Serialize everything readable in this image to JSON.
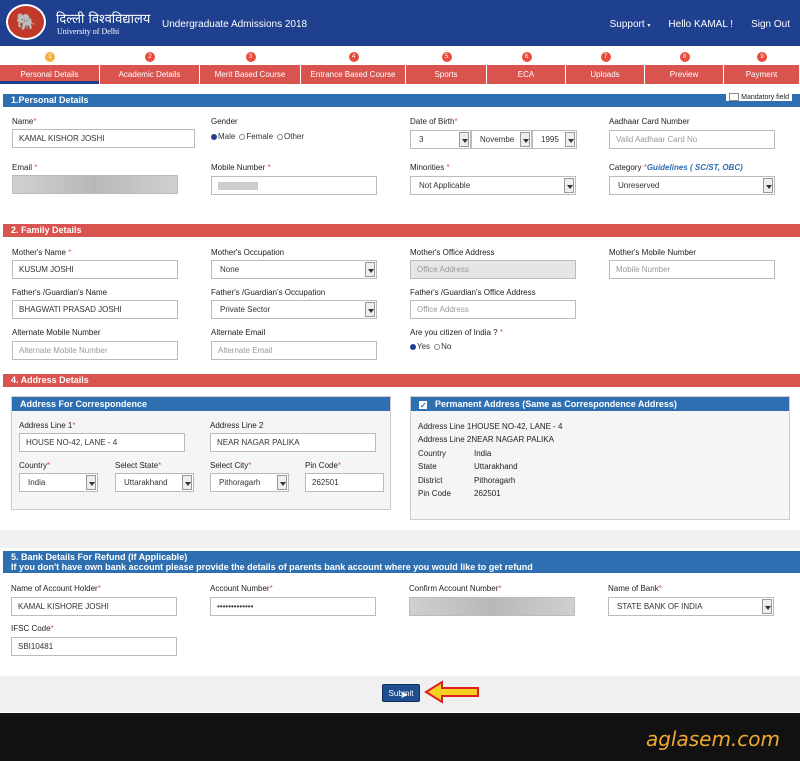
{
  "header": {
    "uni_hindi": "दिल्ली विश्वविद्यालय",
    "uni_english": "University of Delhi",
    "app_title": "Undergraduate Admissions 2018",
    "support": "Support",
    "greeting": "Hello KAMAL !",
    "signout": "Sign Out"
  },
  "steps": [
    {
      "num": "1",
      "label": "Personal Details"
    },
    {
      "num": "2",
      "label": "Academic Details"
    },
    {
      "num": "3",
      "label": "Merit Based Course"
    },
    {
      "num": "4",
      "label": "Entrance Based Course"
    },
    {
      "num": "5",
      "label": "Sports"
    },
    {
      "num": "6",
      "label": "ECA"
    },
    {
      "num": "7",
      "label": "Uploads"
    },
    {
      "num": "8",
      "label": "Preview"
    },
    {
      "num": "9",
      "label": "Payment"
    }
  ],
  "personal": {
    "title": "1.Personal Details",
    "mandatory": "Mandatory field",
    "name_label": "Name",
    "name_value": "KAMAL KISHOR JOSHI",
    "gender_label": "Gender",
    "gender_male": "Male",
    "gender_female": "Female",
    "gender_other": "Other",
    "dob_label": "Date of Birth",
    "dob_day": "3",
    "dob_month": "Novembe",
    "dob_year": "1995",
    "aadhaar_label": "Aadhaar Card Number",
    "aadhaar_placeholder": "Valid Aadhaar Card No",
    "email_label": "Email",
    "mobile_label": "Mobile Number",
    "minorities_label": "Minorities",
    "minorities_value": "Not Applicable",
    "category_label": "Category",
    "guidelines_label": "Guidelines",
    "guide_sc": "SC/ST",
    "guide_obc": "OBC",
    "category_value": "Unreserved"
  },
  "family": {
    "title": "2. Family Details",
    "mother_name_label": "Mother's Name",
    "mother_name_value": "KUSUM JOSHI",
    "mother_occ_label": "Mother's Occupation",
    "mother_occ_value": "None",
    "mother_office_label": "Mother's Office Address",
    "mother_office_placeholder": "Office Address",
    "mother_mobile_label": "Mother's Mobile Number",
    "mother_mobile_placeholder": "Mobile Number",
    "father_name_label": "Father's /Guardian's Name",
    "father_name_value": "BHAGWATI PRASAD JOSHI",
    "father_occ_label": "Father's /Guardian's Occupation",
    "father_occ_value": "Private Sector",
    "father_office_label": "Father's /Guardian's Office Address",
    "father_office_placeholder": "Office Address",
    "alt_mobile_label": "Alternate Mobile Number",
    "alt_mobile_placeholder": "Alternate Mobile Number",
    "alt_email_label": "Alternate Email",
    "alt_email_placeholder": "Alternate Email",
    "citizen_label": "Are you citizen of India ?",
    "citizen_yes": "Yes",
    "citizen_no": "No"
  },
  "address": {
    "title": "4. Address Details",
    "corr_title": "Address For Correspondence",
    "line1_label": "Address Line 1",
    "line1_value": "HOUSE NO-42, LANE - 4",
    "line2_label": "Address Line 2",
    "line2_value": "NEAR NAGAR PALIKA",
    "country_label": "Country",
    "country_value": "India",
    "state_label": "Select State",
    "state_value": "Uttarakhand",
    "city_label": "Select City",
    "city_value": "Pithoragarh",
    "pin_label": "Pin Code",
    "pin_value": "262501",
    "perm_title": "Permanent Address (Same as Correspondence Address)",
    "perm_line1": "Address Line 1HOUSE NO-42, LANE - 4",
    "perm_line2": "Address Line 2NEAR NAGAR PALIKA",
    "perm_country_k": "Country",
    "perm_country_v": "India",
    "perm_state_k": "State",
    "perm_state_v": "Uttarakhand",
    "perm_district_k": "District",
    "perm_district_v": "Pithoragarh",
    "perm_pin_k": "Pin Code",
    "perm_pin_v": "262501"
  },
  "bank": {
    "title": "5. Bank Details For Refund (If Applicable)",
    "subtitle": "If you don't have own bank account please provide the details of parents bank account where you would like to get refund",
    "holder_label": "Name of Account Holder",
    "holder_value": "KAMAL KISHORE JOSHI",
    "acct_label": "Account Number",
    "acct_value": "•••••••••••••",
    "confirm_label": "Confirm Account Number",
    "bank_label": "Name of Bank",
    "bank_value": "STATE BANK OF INDIA",
    "ifsc_label": "IFSC Code",
    "ifsc_value": "SBI10481"
  },
  "submit_label": "Submit",
  "watermark": "aglasem.com",
  "colors": {
    "header": "#1f3f8f",
    "tab": "#d9534f",
    "section_blue": "#2d6fb0",
    "section_red": "#d9534f"
  }
}
